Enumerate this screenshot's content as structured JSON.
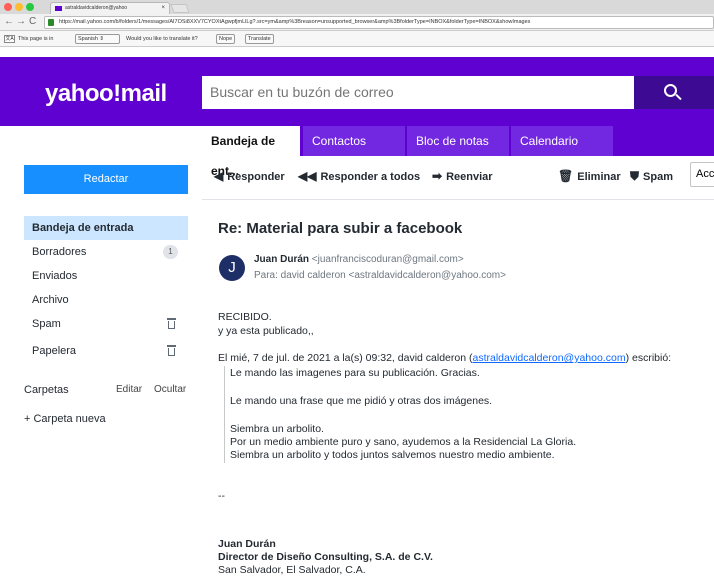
{
  "browser": {
    "tab_title": "astraldavidcalderon@yahoo",
    "tab_close": "×",
    "url": "https://mail.yahoo.com/b/folders/1/messages/AI7OSi8XXV7CYOXtAgwpfjmLlLg?.src=ym&amp%3Breason=unsupported_browser&amp%3BfolderType=INBOX&folderType=INBOX&showImages",
    "translate_text": "This page is in",
    "translate_lang": "Spanish",
    "translate_question": "Would you like to translate it?",
    "nope_label": "Nope",
    "translate_label": "Translate"
  },
  "header": {
    "logo": "yahoo!mail",
    "search_placeholder": "Buscar en tu buzón de correo"
  },
  "tabs": [
    "Bandeja de ent...",
    "Contactos",
    "Bloc de notas",
    "Calendario"
  ],
  "sidebar": {
    "compose_label": "Redactar",
    "folders": [
      {
        "label": "Bandeja de entrada"
      },
      {
        "label": "Borradores",
        "count": "1"
      },
      {
        "label": "Enviados"
      },
      {
        "label": "Archivo"
      },
      {
        "label": "Spam"
      },
      {
        "label": "Papelera"
      }
    ],
    "carpetas_label": "Carpetas",
    "edit_label": "Editar",
    "hide_label": "Ocultar",
    "new_folder_label": "+ Carpeta nueva"
  },
  "toolbar": {
    "reply": "Responder",
    "reply_all": "Responder a todos",
    "forward": "Reenviar",
    "delete": "Eliminar",
    "spam": "Spam",
    "more": "Acc"
  },
  "message": {
    "subject": "Re: Material para subir a facebook",
    "avatar_letter": "J",
    "from_name": "Juan Durán",
    "from_email": "<juanfranciscoduran@gmail.com>",
    "to_line": "Para: david calderon <astraldavidcalderon@yahoo.com>",
    "body_line1": "RECIBIDO.",
    "body_line2": "y ya esta publicado,,",
    "quote_intro_pre": "El mié, 7 de jul. de 2021 a la(s) 09:32, david calderon (",
    "quote_intro_link": "astraldavidcalderon@yahoo.com",
    "quote_intro_post": ") escribió:",
    "quote_lines": [
      "Le mando las imagenes para su publicación. Gracias.",
      "Le mando una frase que me pidió y otras dos imágenes.",
      "Siembra un arbolito.",
      "Por un medio ambiente puro y sano, ayudemos a la Residencial La Gloria.",
      "Siembra un arbolito y todos juntos salvemos nuestro medio ambiente."
    ],
    "separator": "--",
    "sig_name": "Juan Durán",
    "sig_title": "Director de Diseño Consulting, S.A. de C.V.",
    "sig_city": "San Salvador, El Salvador, C.A."
  }
}
